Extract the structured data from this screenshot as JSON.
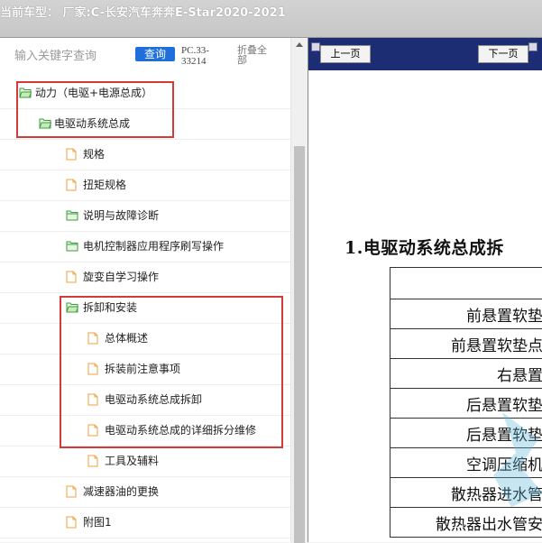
{
  "titlebar": {
    "current_car": "当前车型： 厂家:C-长安汽车奔奔E-Star2020-2021"
  },
  "search": {
    "placeholder": "输入关键字查询",
    "query_label": "查询",
    "code_line1": "PC.33-",
    "code_line2": "33214",
    "collapse_label": "折叠全部"
  },
  "tree": [
    {
      "label": "动力（电驱+电源总成）",
      "type": "folder"
    },
    {
      "label": "电驱动系统总成",
      "type": "folder"
    },
    {
      "label": "规格",
      "type": "file"
    },
    {
      "label": "扭矩规格",
      "type": "file"
    },
    {
      "label": "说明与故障诊断",
      "type": "folder"
    },
    {
      "label": "电机控制器应用程序刷写操作",
      "type": "folder"
    },
    {
      "label": "旋变自学习操作",
      "type": "file"
    },
    {
      "label": "拆卸和安装",
      "type": "folder"
    },
    {
      "label": "总体概述",
      "type": "file"
    },
    {
      "label": "拆装前注意事项",
      "type": "file"
    },
    {
      "label": "电驱动系统总成拆卸",
      "type": "file"
    },
    {
      "label": "电驱动系统总成的详细拆分维修",
      "type": "file"
    },
    {
      "label": "工具及辅料",
      "type": "file"
    },
    {
      "label": "减速器油的更换",
      "type": "file"
    },
    {
      "label": "附图1",
      "type": "file"
    }
  ],
  "viewer": {
    "prev_label": "上一页",
    "next_label": "下一页",
    "doc_title": "1.电驱动系统总成拆",
    "table_rows": [
      "",
      "前悬置软垫",
      "前悬置软垫点",
      "右悬置",
      "后悬置软垫",
      "后悬置软垫",
      "空调压缩机",
      "散热器进水管",
      "散热器出水管安"
    ]
  },
  "colors": {
    "accent": "#1e6fd9",
    "highlight": "#d43a3a",
    "navbar": "#1d2d73",
    "folder": "#3aa040",
    "file": "#f0a040"
  }
}
